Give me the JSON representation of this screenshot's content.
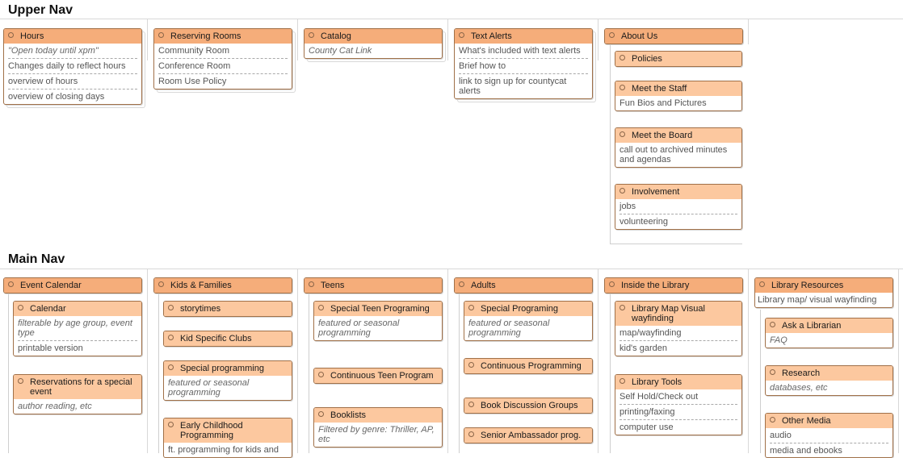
{
  "upper_nav": {
    "title": "Upper Nav",
    "hours": {
      "title": "Hours",
      "items": [
        "\"Open today until xpm\"",
        "Changes daily to reflect hours",
        "overview of hours",
        "overview of closing days"
      ]
    },
    "reserving_rooms": {
      "title": "Reserving Rooms",
      "items": [
        "Community Room",
        "Conference Room",
        "Room Use Policy"
      ]
    },
    "catalog": {
      "title": "Catalog",
      "items": [
        "County Cat Link"
      ]
    },
    "text_alerts": {
      "title": "Text Alerts",
      "items": [
        "What's included with text alerts",
        "Brief how to",
        "link to sign up for countycat alerts"
      ]
    },
    "about_us": {
      "title": "About Us",
      "policies": {
        "title": "Policies"
      },
      "meet_staff": {
        "title": "Meet the Staff",
        "items": [
          "Fun Bios and Pictures"
        ]
      },
      "meet_board": {
        "title": "Meet the Board",
        "items": [
          "call out to archived minutes and agendas"
        ]
      },
      "involvement": {
        "title": "Involvement",
        "items": [
          "jobs",
          "volunteering"
        ]
      }
    }
  },
  "main_nav": {
    "title": "Main Nav",
    "event_calendar": {
      "title": "Event Calendar",
      "calendar": {
        "title": "Calendar",
        "items": [
          "filterable by age group, event type",
          "printable version"
        ]
      },
      "reservations": {
        "title": "Reservations for a special event",
        "items": [
          "author reading, etc"
        ]
      }
    },
    "kids_families": {
      "title": "Kids & Families",
      "storytimes": {
        "title": "storytimes"
      },
      "kid_clubs": {
        "title": "Kid Specific Clubs"
      },
      "special_programming": {
        "title": "Special programming",
        "items": [
          "featured or seasonal programming"
        ]
      },
      "early_childhood": {
        "title": "Early Childhood Programming",
        "items": [
          "ft. programming for kids and"
        ]
      }
    },
    "teens": {
      "title": "Teens",
      "special_teen": {
        "title": "Special Teen Programing",
        "items": [
          "featured or seasonal programming"
        ]
      },
      "continuous_teen": {
        "title": "Continuous Teen Program"
      },
      "booklists": {
        "title": "Booklists",
        "items": [
          "Filtered by genre: Thriller, AP, etc"
        ]
      }
    },
    "adults": {
      "title": "Adults",
      "special_programing": {
        "title": "Special Programing",
        "items": [
          "featured or seasonal programming"
        ]
      },
      "continuous_programming": {
        "title": "Continuous Programming"
      },
      "book_discussion": {
        "title": "Book Discussion Groups"
      },
      "senior_ambassador": {
        "title": "Senior Ambassador prog."
      }
    },
    "inside_library": {
      "title": "Inside the Library",
      "map_visual": {
        "title": "Library Map Visual wayfinding",
        "items": [
          "map/wayfinding",
          "kid's garden"
        ]
      },
      "library_tools": {
        "title": "Library Tools",
        "items": [
          "Self Hold/Check out",
          "printing/faxing",
          "computer use"
        ]
      }
    },
    "library_resources": {
      "title": "Library Resources",
      "items": [
        "Library map/ visual wayfinding"
      ],
      "ask_librarian": {
        "title": "Ask a Librarian",
        "items": [
          "FAQ"
        ]
      },
      "research": {
        "title": "Research",
        "items": [
          "databases, etc"
        ]
      },
      "other_media": {
        "title": "Other Media",
        "items": [
          "audio",
          "media and ebooks"
        ]
      }
    }
  }
}
